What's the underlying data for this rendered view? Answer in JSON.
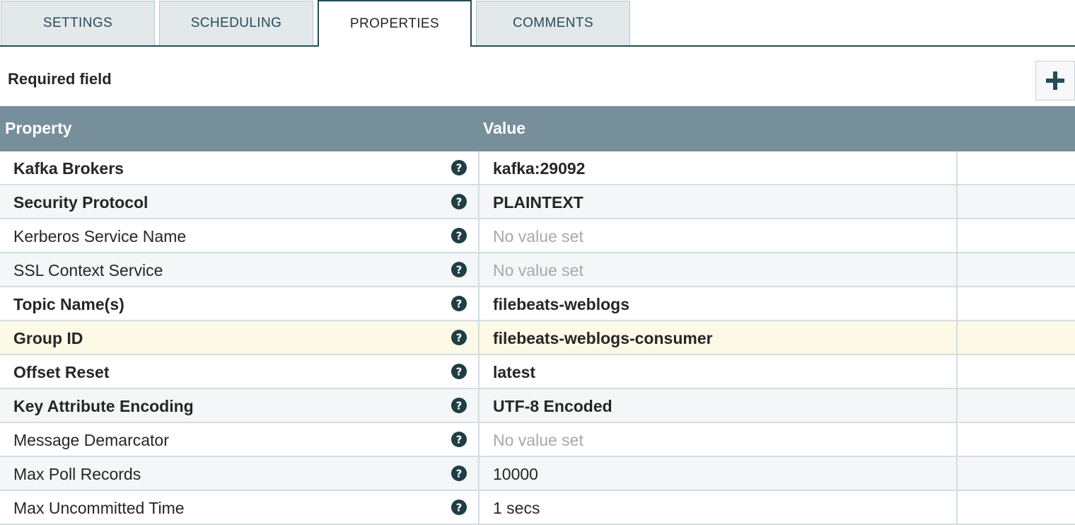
{
  "tabs": [
    {
      "label": "SETTINGS",
      "active": false
    },
    {
      "label": "SCHEDULING",
      "active": false
    },
    {
      "label": "PROPERTIES",
      "active": true
    },
    {
      "label": "COMMENTS",
      "active": false
    }
  ],
  "header": {
    "required_label": "Required field",
    "add_icon": "plus-icon"
  },
  "table": {
    "columns": [
      "Property",
      "Value"
    ],
    "rows": [
      {
        "name": "Kafka Brokers",
        "required": true,
        "value": "kafka:29092",
        "value_state": "set"
      },
      {
        "name": "Security Protocol",
        "required": true,
        "value": "PLAINTEXT",
        "value_state": "set"
      },
      {
        "name": "Kerberos Service Name",
        "required": false,
        "value": "No value set",
        "value_state": "unset"
      },
      {
        "name": "SSL Context Service",
        "required": false,
        "value": "No value set",
        "value_state": "unset"
      },
      {
        "name": "Topic Name(s)",
        "required": true,
        "value": "filebeats-weblogs",
        "value_state": "set"
      },
      {
        "name": "Group ID",
        "required": true,
        "value": "filebeats-weblogs-consumer",
        "value_state": "set",
        "highlighted": true
      },
      {
        "name": "Offset Reset",
        "required": true,
        "value": "latest",
        "value_state": "set"
      },
      {
        "name": "Key Attribute Encoding",
        "required": true,
        "value": "UTF-8 Encoded",
        "value_state": "set"
      },
      {
        "name": "Message Demarcator",
        "required": false,
        "value": "No value set",
        "value_state": "unset"
      },
      {
        "name": "Max Poll Records",
        "required": false,
        "value": "10000",
        "value_state": "plain"
      },
      {
        "name": "Max Uncommitted Time",
        "required": false,
        "value": "1 secs",
        "value_state": "plain"
      }
    ]
  },
  "colors": {
    "accent": "#264c57",
    "header_bg": "#778e9b",
    "highlight_row": "#fdf9e7",
    "unset_value": "#a8a8a8"
  }
}
